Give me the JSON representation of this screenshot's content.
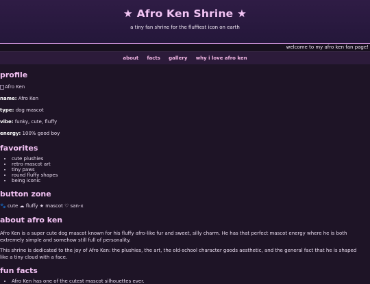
{
  "header": {
    "title": "★ Afro Ken Shrine ★",
    "tagline": "a tiny fan shrine for the fluffiest icon on earth"
  },
  "marquee": "welcome to my afro ken fan page!",
  "nav": [
    "about",
    "facts",
    "gallery",
    "why i love afro ken"
  ],
  "profile": {
    "heading": "profile",
    "image_alt": "Afro Ken",
    "fields": [
      {
        "label": "name:",
        "value": "Afro Ken"
      },
      {
        "label": "type:",
        "value": "dog mascot"
      },
      {
        "label": "vibe:",
        "value": "funky, cute, fluffy"
      },
      {
        "label": "energy:",
        "value": "100% good boy"
      }
    ]
  },
  "favorites": {
    "heading": "favorites",
    "items": [
      "cute plushies",
      "retro mascot art",
      "tiny paws",
      "round fluffy shapes",
      "being iconic"
    ]
  },
  "button_zone": {
    "heading": "button zone",
    "badges": "🐾 cute ☁ fluffy ★ mascot ♡ san-x"
  },
  "about": {
    "heading": "about afro ken",
    "paragraphs": [
      "Afro Ken is a super cute dog mascot known for his fluffy afro-like fur and sweet, silly charm. He has that perfect mascot energy where he is both extremely simple and somehow still full of personality.",
      "This shrine is dedicated to the joy of Afro Ken: the plushies, the art, the old-school character goods aesthetic, and the general fact that he is shaped like a tiny cloud with a face."
    ]
  },
  "facts": {
    "heading": "fun facts",
    "items": [
      "Afro Ken has one of the cutest mascot silhouettes ever."
    ]
  },
  "colors": {
    "background": "#1e1426",
    "header": "#2f1c45",
    "accent": "#f3c2f4",
    "nav_link": "#f6b9e7"
  }
}
